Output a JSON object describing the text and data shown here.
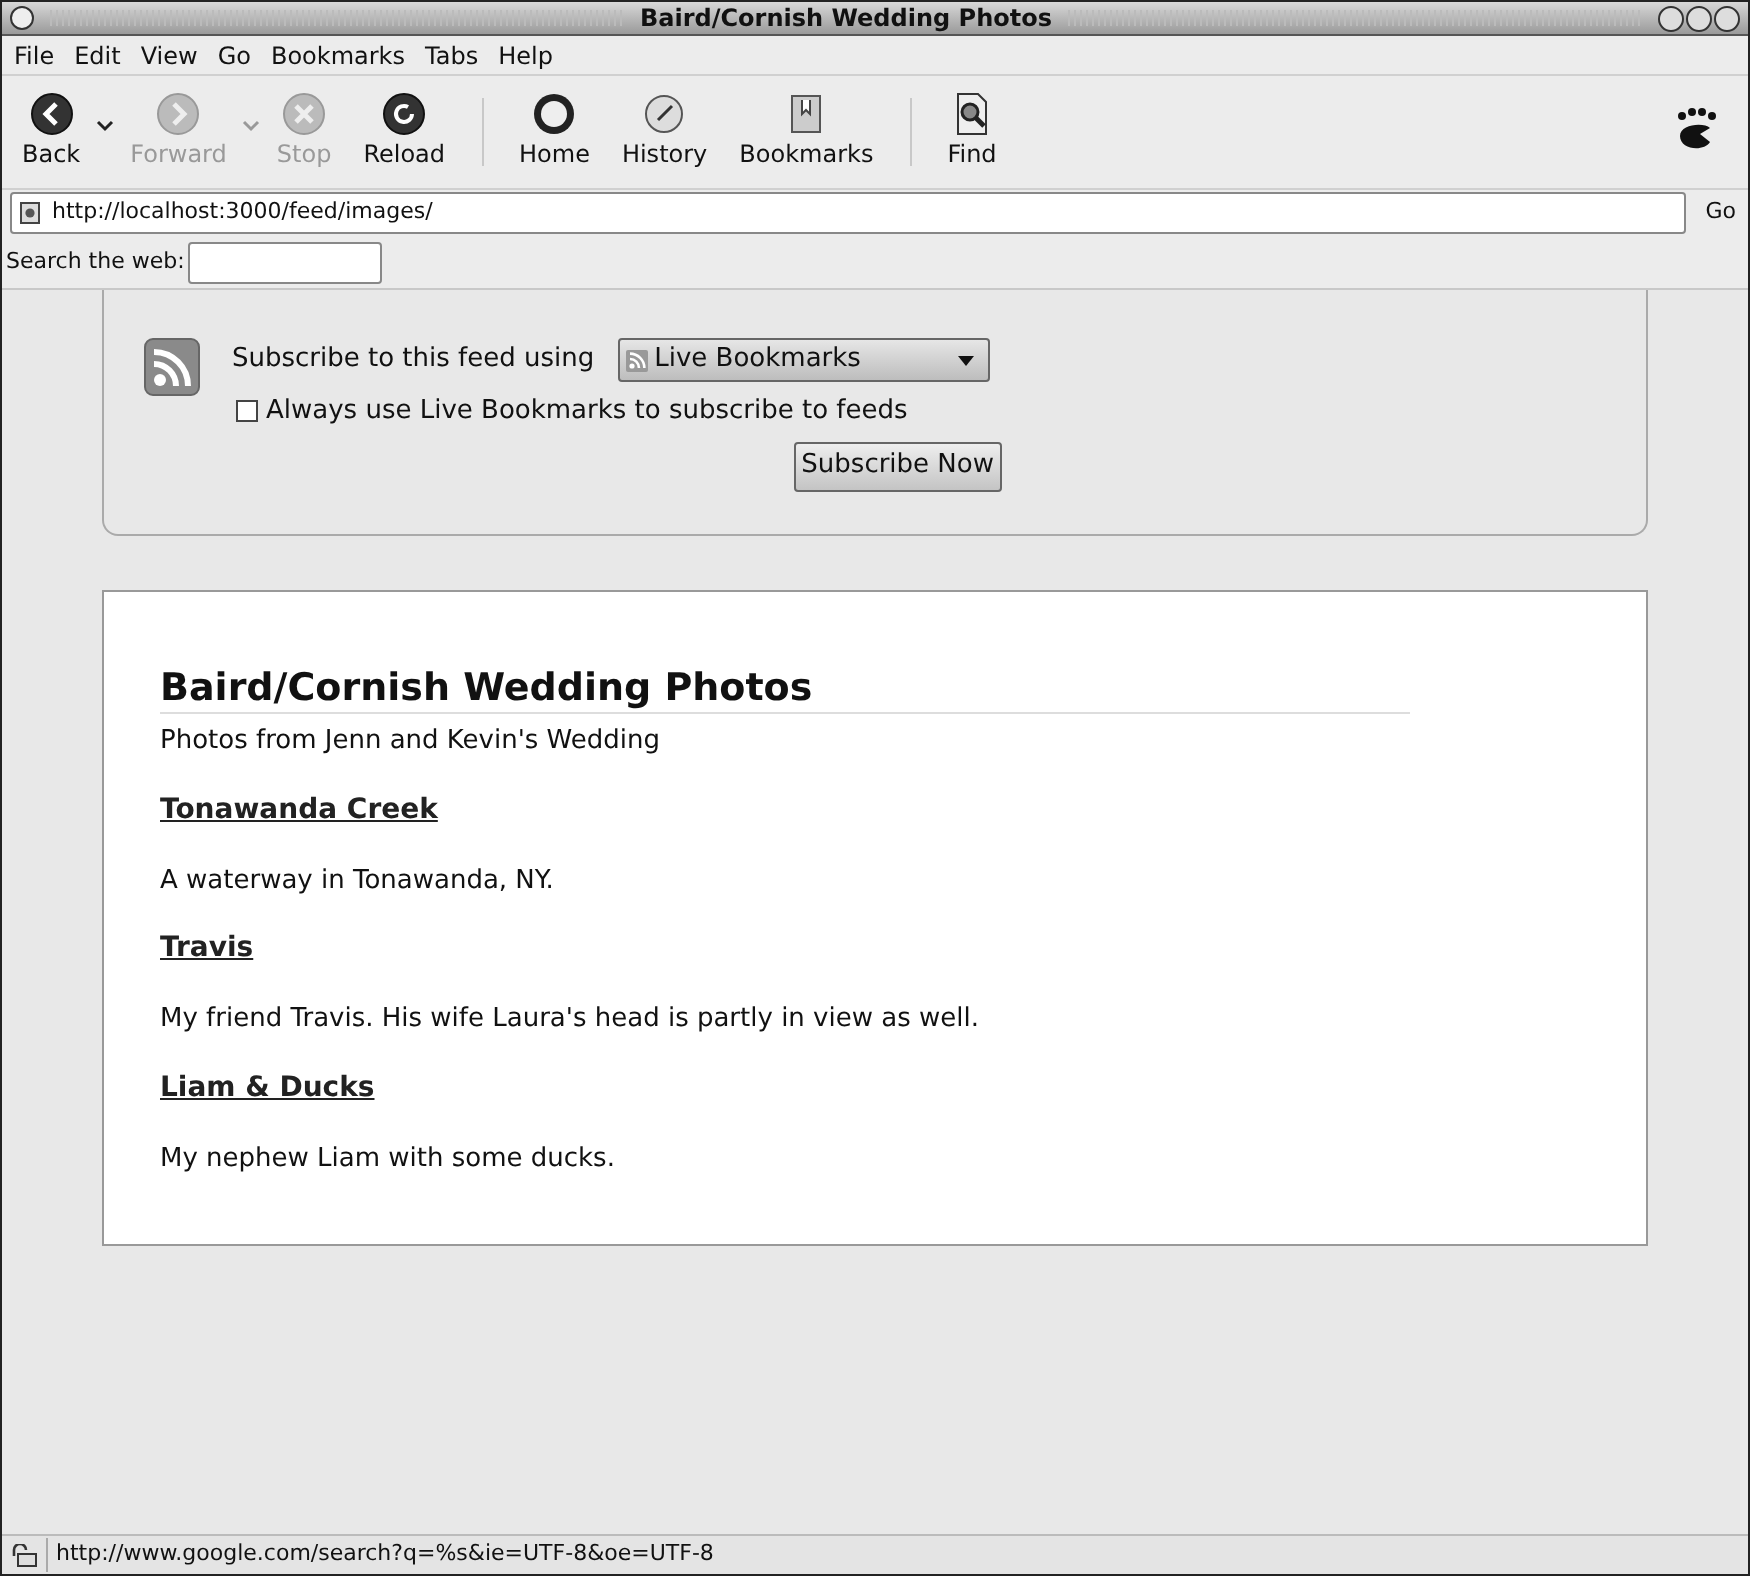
{
  "window": {
    "title": "Baird/Cornish Wedding Photos"
  },
  "menu": [
    "File",
    "Edit",
    "View",
    "Go",
    "Bookmarks",
    "Tabs",
    "Help"
  ],
  "toolbar": [
    {
      "label": "Back",
      "kind": "back",
      "disabled": false,
      "dropdown": true
    },
    {
      "label": "Forward",
      "kind": "forward",
      "disabled": true,
      "dropdown": true
    },
    {
      "label": "Stop",
      "kind": "stop",
      "disabled": true,
      "dropdown": false
    },
    {
      "label": "Reload",
      "kind": "reload",
      "disabled": false,
      "dropdown": false
    },
    {
      "kind": "separator"
    },
    {
      "label": "Home",
      "kind": "home",
      "disabled": false,
      "dropdown": false
    },
    {
      "label": "History",
      "kind": "history",
      "disabled": false,
      "dropdown": false
    },
    {
      "label": "Bookmarks",
      "kind": "bookmarks",
      "disabled": false,
      "dropdown": false
    },
    {
      "kind": "separator"
    },
    {
      "label": "Find",
      "kind": "find",
      "disabled": false,
      "dropdown": false
    }
  ],
  "address": {
    "value": "http://localhost:3000/feed/images/",
    "go": "Go"
  },
  "search": {
    "label": "Search the web:"
  },
  "subscribe": {
    "prompt": "Subscribe to this feed using",
    "reader": "Live Bookmarks",
    "always_label": "Always use Live Bookmarks to subscribe to feeds",
    "always_checked": false,
    "button": "Subscribe Now"
  },
  "feed": {
    "title": "Baird/Cornish Wedding Photos",
    "subtitle": "Photos from Jenn and Kevin's Wedding",
    "entries": [
      {
        "title": "Tonawanda Creek",
        "description": "A waterway in Tonawanda, NY."
      },
      {
        "title": "Travis",
        "description": "My friend Travis. His wife Laura's head is partly in view as well."
      },
      {
        "title": "Liam & Ducks",
        "description": "My nephew Liam with some ducks."
      }
    ]
  },
  "status_bar": {
    "text": "http://www.google.com/search?q=%s&ie=UTF-8&oe=UTF-8"
  }
}
